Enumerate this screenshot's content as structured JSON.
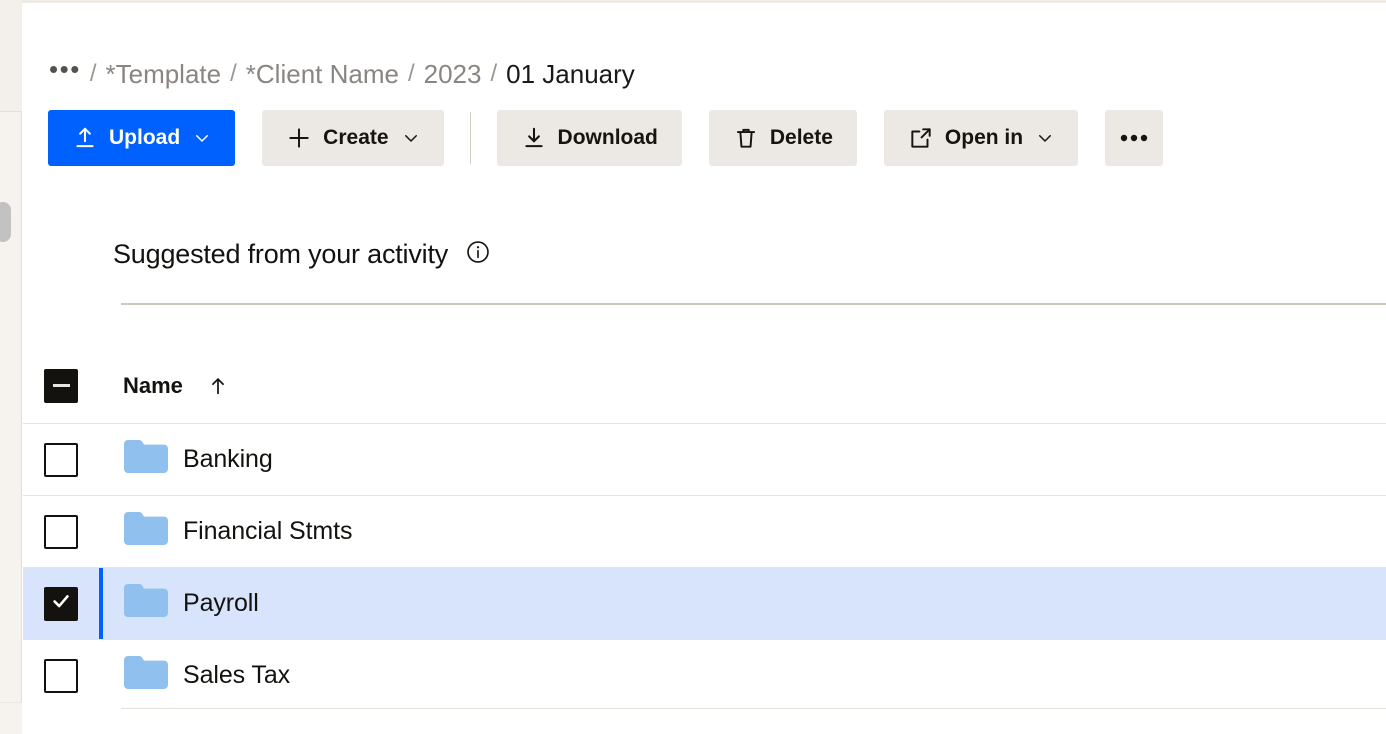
{
  "breadcrumb": {
    "overflow": "•••",
    "separator": "/",
    "items": [
      {
        "label": "*Template",
        "current": false
      },
      {
        "label": "*Client Name",
        "current": false
      },
      {
        "label": "2023",
        "current": false
      },
      {
        "label": "01 January",
        "current": true
      }
    ]
  },
  "toolbar": {
    "upload_label": "Upload",
    "create_label": "Create",
    "download_label": "Download",
    "delete_label": "Delete",
    "open_in_label": "Open in",
    "overflow_label": "•••",
    "primary_color": "#0061fe",
    "button_bg": "#ece9e4"
  },
  "suggested": {
    "title": "Suggested from your activity",
    "info_icon": "info-icon"
  },
  "table": {
    "header": {
      "select_all_state": "indeterminate",
      "name_column": "Name",
      "sort_direction": "ascending",
      "sort_glyph": "↑"
    },
    "rows": [
      {
        "name": "Banking",
        "icon": "folder-icon",
        "checked": false,
        "selected": false
      },
      {
        "name": "Financial Stmts",
        "icon": "folder-icon",
        "checked": false,
        "selected": false
      },
      {
        "name": "Payroll",
        "icon": "folder-icon",
        "checked": true,
        "selected": true
      },
      {
        "name": "Sales Tax",
        "icon": "folder-icon",
        "checked": false,
        "selected": false
      }
    ],
    "selected_row_bg": "#d7e4fb",
    "folder_color": "#8fc0ee"
  }
}
